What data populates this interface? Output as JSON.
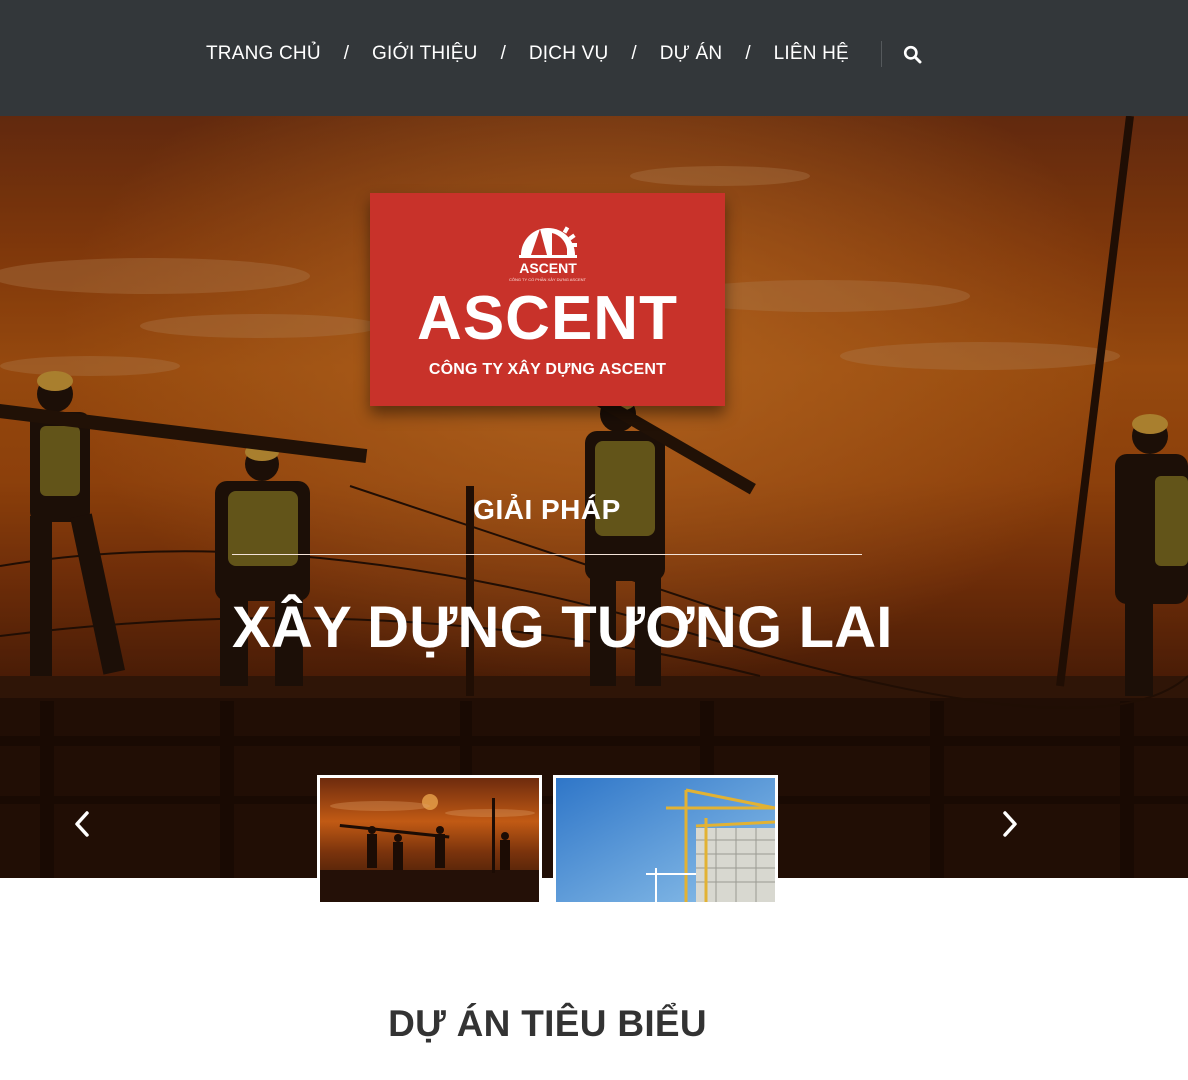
{
  "nav": {
    "items": [
      "TRANG CHỦ",
      "GIỚI THIỆU",
      "DỊCH VỤ",
      "DỰ ÁN",
      "LIÊN HỆ"
    ],
    "separator": "/",
    "search_icon": "search-icon"
  },
  "hero": {
    "logo": {
      "mark_text": "ASCENT",
      "mark_tagline": "CÔNG TY CỔ PHẦN XÂY DỰNG ASCENT",
      "brand_name": "ASCENT",
      "brand_subtitle": "CÔNG TY XÂY DỰNG ASCENT"
    },
    "kicker": "GIẢI PHÁP",
    "title": "XÂY DỰNG TƯƠNG LAI",
    "prev_icon": "chevron-left-icon",
    "next_icon": "chevron-right-icon",
    "thumbnails": [
      {
        "name": "sunset-construction-workers"
      },
      {
        "name": "tower-cranes-building"
      }
    ]
  },
  "section": {
    "title": "DỰ ÁN TIÊU BIỂU"
  },
  "colors": {
    "topbar": "#33373a",
    "brand_red": "#c8322a",
    "text_dark": "#333333"
  }
}
